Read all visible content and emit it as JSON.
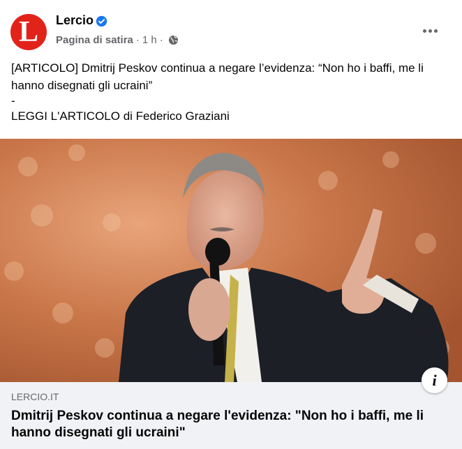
{
  "post": {
    "page_name": "Lercio",
    "avatar_letter": "L",
    "category": "Pagina di satira",
    "separator": "·",
    "time": "1 h",
    "separator2": "·",
    "text_line1": "[ARTICOLO] Dmitrij Peskov continua a negare l’evidenza: “Non ho i baffi, me li hanno disegnati gli ucraini”",
    "text_dash": "-",
    "text_line3": "LEGGI L'ARTICOLO di Federico Graziani"
  },
  "link_preview": {
    "domain": "LERCIO.IT",
    "title": "Dmitrij Peskov continua a negare l'evidenza: \"Non ho i baffi, me li hanno disegnati gli ucraini\"",
    "info_label": "i"
  },
  "colors": {
    "brand_red": "#e2231a",
    "verified_blue": "#1877f2",
    "meta_gray": "#65676b",
    "link_box_bg": "#f0f2f5"
  },
  "icons": {
    "verified": "verified-badge-icon",
    "audience": "globe-icon",
    "menu": "more-options-icon",
    "info": "info-icon"
  }
}
